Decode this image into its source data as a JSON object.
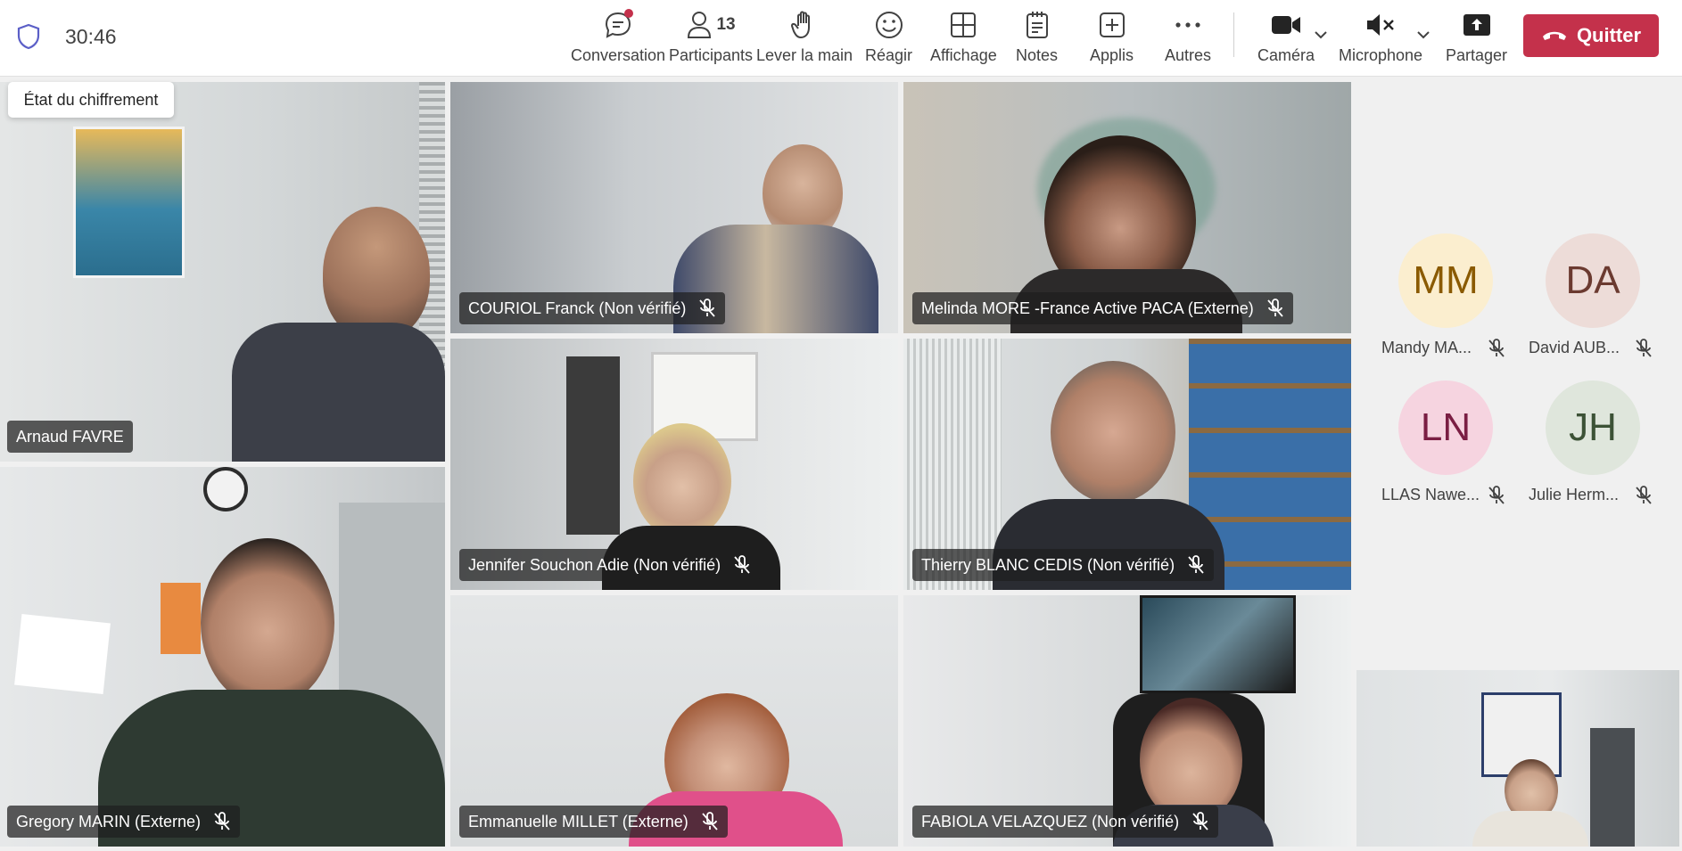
{
  "header": {
    "timer": "30:46",
    "toolbar": {
      "conversation": "Conversation",
      "participants": "Participants",
      "participant_count": "13",
      "raise_hand": "Lever la main",
      "react": "Réagir",
      "view": "Affichage",
      "notes": "Notes",
      "apps": "Applis",
      "more": "Autres",
      "camera": "Caméra",
      "microphone": "Microphone",
      "share": "Partager",
      "leave": "Quitter"
    },
    "tooltip": "État du chiffrement"
  },
  "tiles": [
    {
      "name": "Arnaud FAVRE"
    },
    {
      "name": "COURIOL Franck (Non vérifié)"
    },
    {
      "name": "Melinda MORE -France Active PACA (Externe)"
    },
    {
      "name": "Jennifer Souchon Adie (Non vérifié)"
    },
    {
      "name": "Thierry BLANC CEDIS (Non vérifié)"
    },
    {
      "name": "Gregory MARIN (Externe)"
    },
    {
      "name": "Emmanuelle MILLET (Externe)"
    },
    {
      "name": "FABIOLA VELAZQUEZ (Non vérifié)"
    }
  ],
  "avatars": [
    {
      "initials": "MM",
      "name": "Mandy MA...",
      "bg": "#fbeecf",
      "fg": "#8a5a00"
    },
    {
      "initials": "DA",
      "name": "David AUB...",
      "bg": "#eddcd8",
      "fg": "#6b3a30"
    },
    {
      "initials": "LN",
      "name": "LLAS Nawe...",
      "bg": "#f6d4e0",
      "fg": "#7a1e43"
    },
    {
      "initials": "JH",
      "name": "Julie Herm...",
      "bg": "#dfe6dc",
      "fg": "#3c5236"
    }
  ],
  "colors": {
    "leave_button": "#c4314b",
    "notification_dot": "#c4314b"
  }
}
